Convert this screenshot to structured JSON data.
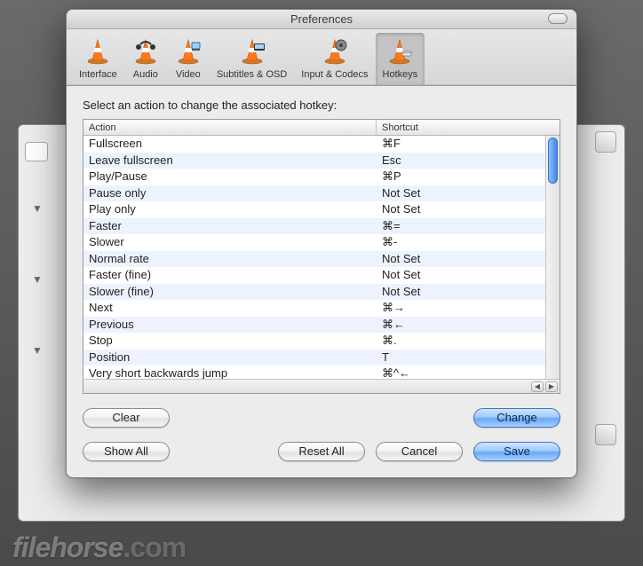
{
  "window": {
    "title": "Preferences",
    "instruction": "Select an action to change the associated hotkey:"
  },
  "toolbar": {
    "items": [
      {
        "label": "Interface"
      },
      {
        "label": "Audio"
      },
      {
        "label": "Video"
      },
      {
        "label": "Subtitles & OSD"
      },
      {
        "label": "Input & Codecs"
      },
      {
        "label": "Hotkeys"
      }
    ],
    "selected": 5
  },
  "table": {
    "headers": {
      "action": "Action",
      "shortcut": "Shortcut"
    },
    "rows": [
      {
        "action": "Fullscreen",
        "shortcut": "⌘F"
      },
      {
        "action": "Leave fullscreen",
        "shortcut": "Esc"
      },
      {
        "action": "Play/Pause",
        "shortcut": "⌘P"
      },
      {
        "action": "Pause only",
        "shortcut": "Not Set"
      },
      {
        "action": "Play only",
        "shortcut": "Not Set"
      },
      {
        "action": "Faster",
        "shortcut": "⌘="
      },
      {
        "action": "Slower",
        "shortcut": "⌘-"
      },
      {
        "action": "Normal rate",
        "shortcut": "Not Set"
      },
      {
        "action": "Faster (fine)",
        "shortcut": "Not Set"
      },
      {
        "action": "Slower (fine)",
        "shortcut": "Not Set"
      },
      {
        "action": "Next",
        "shortcut": "⌘→"
      },
      {
        "action": "Previous",
        "shortcut": "⌘←"
      },
      {
        "action": "Stop",
        "shortcut": "⌘."
      },
      {
        "action": "Position",
        "shortcut": "T"
      },
      {
        "action": "Very short backwards jump",
        "shortcut": "⌘^←"
      }
    ]
  },
  "buttons": {
    "clear": "Clear",
    "change": "Change",
    "show_all": "Show All",
    "reset_all": "Reset All",
    "cancel": "Cancel",
    "save": "Save"
  },
  "watermark": "filehorse",
  "watermark_suffix": ".com"
}
